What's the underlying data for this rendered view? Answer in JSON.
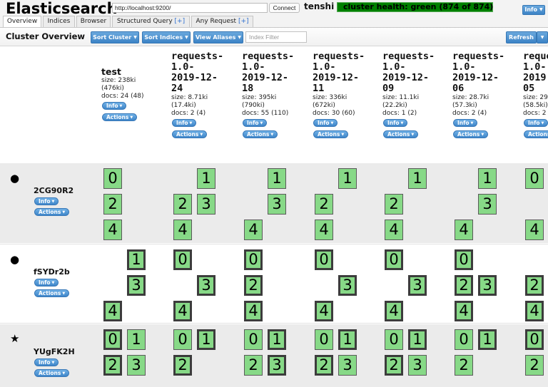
{
  "header": {
    "app_title": "Elasticsearch",
    "url_value": "http://localhost:9200/",
    "connect_label": "Connect",
    "cluster_name": "tenshi",
    "cluster_health": "cluster health: green (874 of 874)",
    "cluster_health_color": "#008000",
    "info_label": "Info"
  },
  "tabs": [
    {
      "label": "Overview",
      "plus": ""
    },
    {
      "label": "Indices",
      "plus": ""
    },
    {
      "label": "Browser",
      "plus": ""
    },
    {
      "label": "Structured Query ",
      "plus": "[+]"
    },
    {
      "label": "Any Request ",
      "plus": "[+]"
    }
  ],
  "toolbar": {
    "title": "Cluster Overview",
    "sort_cluster_label": "Sort Cluster",
    "sort_indices_label": "Sort Indices",
    "view_aliases_label": "View Aliases",
    "index_filter_placeholder": "Index Filter",
    "refresh_label": "Refresh"
  },
  "index_buttons": {
    "info": "Info",
    "actions": "Actions"
  },
  "indices": [
    {
      "name": "test",
      "size": "size: 238ki",
      "size_total": "(476ki)",
      "docs": "docs: 24 (48)"
    },
    {
      "name": "requests-\n1.0-\n2019-12-\n24",
      "size": "size: 8.71ki",
      "size_total": "(17.4ki)",
      "docs": "docs: 2 (4)"
    },
    {
      "name": "requests-\n1.0-\n2019-12-\n18",
      "size": "size: 395ki",
      "size_total": "(790ki)",
      "docs": "docs: 55 (110)"
    },
    {
      "name": "requests-\n1.0-\n2019-12-\n11",
      "size": "size: 336ki",
      "size_total": "(672ki)",
      "docs": "docs: 30 (60)"
    },
    {
      "name": "requests-\n1.0-\n2019-12-\n09",
      "size": "size: 11.1ki",
      "size_total": "(22.2ki)",
      "docs": "docs: 1 (2)"
    },
    {
      "name": "requests-\n1.0-\n2019-12-\n06",
      "size": "size: 28.7ki",
      "size_total": "(57.3ki)",
      "docs": "docs: 2 (4)"
    },
    {
      "name": "reque\n1.0-\n2019\n05",
      "size": "size: 29",
      "size_total": "(58.5ki)",
      "docs": "docs: 2"
    }
  ],
  "nodes": [
    {
      "name": "2CG90R2",
      "icon": "circle-icon",
      "glyph": "●",
      "shards": [
        [
          {
            "n": 0,
            "p": false
          },
          {
            "n": 2,
            "p": false
          },
          {
            "n": 4,
            "p": false
          }
        ],
        [
          {
            "n": 1,
            "p": false
          },
          {
            "n": 2,
            "p": false
          },
          {
            "n": 3,
            "p": false
          },
          {
            "n": 4,
            "p": false
          }
        ],
        [
          {
            "n": 1,
            "p": false
          },
          {
            "n": 3,
            "p": false
          },
          {
            "n": 4,
            "p": false
          }
        ],
        [
          {
            "n": 1,
            "p": false
          },
          {
            "n": 2,
            "p": false
          },
          {
            "n": 4,
            "p": false
          }
        ],
        [
          {
            "n": 1,
            "p": false
          },
          {
            "n": 2,
            "p": false
          },
          {
            "n": 4,
            "p": false
          }
        ],
        [
          {
            "n": 1,
            "p": false
          },
          {
            "n": 3,
            "p": false
          },
          {
            "n": 4,
            "p": false
          }
        ],
        [
          {
            "n": 0,
            "p": false
          },
          {
            "n": 4,
            "p": false
          }
        ]
      ]
    },
    {
      "name": "fSYDr2b",
      "icon": "circle-icon",
      "glyph": "●",
      "shards": [
        [
          {
            "n": 1,
            "p": true
          },
          {
            "n": 3,
            "p": true
          },
          {
            "n": 4,
            "p": true
          }
        ],
        [
          {
            "n": 0,
            "p": true
          },
          {
            "n": 3,
            "p": true
          },
          {
            "n": 4,
            "p": true
          }
        ],
        [
          {
            "n": 0,
            "p": true
          },
          {
            "n": 2,
            "p": true
          },
          {
            "n": 4,
            "p": true
          }
        ],
        [
          {
            "n": 0,
            "p": true
          },
          {
            "n": 3,
            "p": true
          },
          {
            "n": 4,
            "p": true
          }
        ],
        [
          {
            "n": 0,
            "p": true
          },
          {
            "n": 3,
            "p": true
          },
          {
            "n": 4,
            "p": true
          }
        ],
        [
          {
            "n": 0,
            "p": true
          },
          {
            "n": 2,
            "p": true
          },
          {
            "n": 3,
            "p": true
          },
          {
            "n": 4,
            "p": true
          }
        ],
        [
          {
            "n": 2,
            "p": true
          },
          {
            "n": 4,
            "p": true
          }
        ]
      ]
    },
    {
      "name": "YUgFK2H",
      "icon": "star-icon",
      "glyph": "★",
      "shards": [
        [
          {
            "n": 0,
            "p": true
          },
          {
            "n": 1,
            "p": false
          },
          {
            "n": 2,
            "p": true
          },
          {
            "n": 3,
            "p": false
          }
        ],
        [
          {
            "n": 0,
            "p": false
          },
          {
            "n": 1,
            "p": true
          },
          {
            "n": 2,
            "p": true
          }
        ],
        [
          {
            "n": 0,
            "p": false
          },
          {
            "n": 1,
            "p": true
          },
          {
            "n": 2,
            "p": false
          },
          {
            "n": 3,
            "p": true
          }
        ],
        [
          {
            "n": 0,
            "p": false
          },
          {
            "n": 1,
            "p": true
          },
          {
            "n": 2,
            "p": true
          },
          {
            "n": 3,
            "p": false
          }
        ],
        [
          {
            "n": 0,
            "p": false
          },
          {
            "n": 1,
            "p": true
          },
          {
            "n": 2,
            "p": true
          },
          {
            "n": 3,
            "p": false
          }
        ],
        [
          {
            "n": 0,
            "p": false
          },
          {
            "n": 1,
            "p": true
          },
          {
            "n": 2,
            "p": false
          }
        ],
        [
          {
            "n": 0,
            "p": true
          },
          {
            "n": 2,
            "p": false
          }
        ]
      ]
    }
  ]
}
